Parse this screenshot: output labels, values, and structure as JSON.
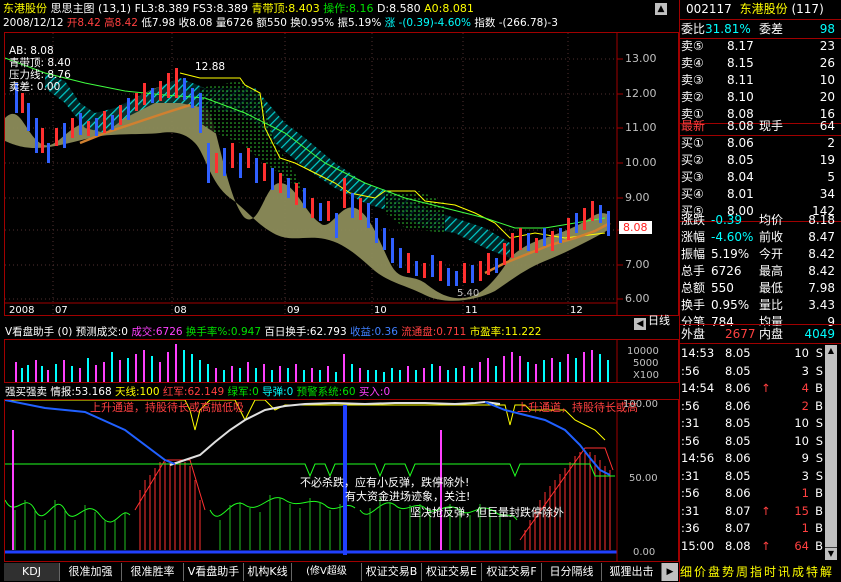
{
  "title_bar": {
    "stock_name": "东港股份",
    "indicator": "思思主图",
    "params": "(13,1)",
    "fl3": "FL3:8.389",
    "fs3": "FS3:8.389",
    "qingdai": "青带顶:8.403",
    "caozuo": "操作:8.16",
    "d": "D:8.580",
    "a0": "A0:8.081"
  },
  "info_bar": {
    "date": "2008/12/12",
    "open": "开8.42",
    "high": "高8.42",
    "low": "低7.98",
    "close": "收8.08",
    "volume": "量6726",
    "amount": "额550",
    "turnover": "换0.95%",
    "amplitude": "振5.19%",
    "change": "涨 -(0.39)-4.60%",
    "index": "指数 -(266.78)-3"
  },
  "main_legend": {
    "ab": "AB: 8.08",
    "qingdai": "青带顶: 8.40",
    "yali": "压力线: 8.76",
    "maicha": "卖差: 0.00"
  },
  "price_chart": {
    "ticks": [
      "13.00",
      "12.00",
      "11.00",
      "10.00",
      "9.00",
      "8.00",
      "7.00",
      "6.00"
    ],
    "high_label": "12.88",
    "low_label": "5.40",
    "current_price": "8.08",
    "x_labels": [
      "2008",
      "07",
      "08",
      "09",
      "10",
      "11",
      "12"
    ],
    "tail_label": "日线"
  },
  "volume_panel": {
    "label": "V看盘助手 (0)",
    "yuce": "预测成交:0",
    "chengjiao": "成交:6726",
    "huanshou": "换手率%:0.947",
    "baiday": "百日换手:62.793",
    "shouyi": "收益:0.36",
    "liutong": "流通盘:0.711",
    "pe": "市盈率:11.222",
    "ticks": [
      "10000",
      "5000",
      "X100"
    ]
  },
  "signal_panel": {
    "label": "强买强卖",
    "qingbao": "情报:53.168",
    "tianxian": "天线:100",
    "hongjun": "红军:62.149",
    "lvjun": "绿军:0",
    "daodan": "导弹:0",
    "yujing": "预警系统:60",
    "mairu": "买入:0",
    "ticks": [
      "100.00",
      "50.00",
      "0.00"
    ],
    "text_upper1": "上升通道，持股待长或高抛低吸",
    "text_upper2": "上升通道，持股待长或高",
    "text_mid1": "不必杀跌，应有小反弹，跌停除外!",
    "text_mid2": "有大资金进场迹象，关注!",
    "text_mid3": "坚决抢反弹，但巨量封跌停除外"
  },
  "tabs": [
    "KDJ",
    "很准加强",
    "很准胜率",
    "V看盘助手",
    "机构K线",
    "(修V超级MACD)",
    "权证交易B",
    "权证交易E",
    "权证交易F",
    "日分隔线",
    "狐狸出击"
  ],
  "quote": {
    "code": "002117",
    "name": "东港股份",
    "count": "(117)",
    "weibi_label": "委比",
    "weibi": "31.81%",
    "weicha_label": "委差",
    "weicha": "98",
    "sell": [
      {
        "label": "卖⑤",
        "price": "8.17",
        "vol": "23"
      },
      {
        "label": "卖④",
        "price": "8.15",
        "vol": "26"
      },
      {
        "label": "卖③",
        "price": "8.11",
        "vol": "10"
      },
      {
        "label": "卖②",
        "price": "8.10",
        "vol": "20"
      },
      {
        "label": "卖①",
        "price": "8.08",
        "vol": "16"
      }
    ],
    "buy": [
      {
        "label": "买①",
        "price": "8.06",
        "vol": "2"
      },
      {
        "label": "买②",
        "price": "8.05",
        "vol": "19"
      },
      {
        "label": "买③",
        "price": "8.04",
        "vol": "5"
      },
      {
        "label": "买④",
        "price": "8.01",
        "vol": "34"
      },
      {
        "label": "买⑤",
        "price": "8.00",
        "vol": "142"
      }
    ],
    "latest_label": "最新",
    "latest": "8.08",
    "xianshou_label": "现手",
    "xianshou": "64",
    "stats": [
      {
        "l1": "涨跌",
        "v1": "-0.39",
        "l2": "均价",
        "v2": "8.18"
      },
      {
        "l1": "涨幅",
        "v1": "-4.60%",
        "l2": "前收",
        "v2": "8.47"
      },
      {
        "l1": "振幅",
        "v1": "5.19%",
        "l2": "今开",
        "v2": "8.42"
      },
      {
        "l1": "总手",
        "v1": "6726",
        "l2": "最高",
        "v2": "8.42"
      },
      {
        "l1": "总额",
        "v1": "550",
        "l2": "最低",
        "v2": "7.98"
      },
      {
        "l1": "换手",
        "v1": "0.95%",
        "l2": "量比",
        "v2": "3.43"
      },
      {
        "l1": "分笔",
        "v1": "784",
        "l2": "均量",
        "v2": "9"
      }
    ],
    "waipan_label": "外盘",
    "waipan": "2677",
    "neipan_label": "内盘",
    "neipan": "4049"
  },
  "ticks_list": [
    {
      "time": "14:53",
      "price": "8.05",
      "arrow": "",
      "vol": "10",
      "side": "S"
    },
    {
      "time": ":56",
      "price": "8.05",
      "arrow": "",
      "vol": "3",
      "side": "S"
    },
    {
      "time": "14:54",
      "price": "8.06",
      "arrow": "↑",
      "vol": "4",
      "side": "B"
    },
    {
      "time": ":56",
      "price": "8.06",
      "arrow": "",
      "vol": "2",
      "side": "B"
    },
    {
      "time": ":31",
      "price": "8.05",
      "arrow": "",
      "vol": "10",
      "side": "S"
    },
    {
      "time": ":56",
      "price": "8.05",
      "arrow": "",
      "vol": "10",
      "side": "S"
    },
    {
      "time": "14:56",
      "price": "8.06",
      "arrow": "",
      "vol": "9",
      "side": "S"
    },
    {
      "time": ":31",
      "price": "8.05",
      "arrow": "",
      "vol": "3",
      "side": "S"
    },
    {
      "time": ":56",
      "price": "8.06",
      "arrow": "",
      "vol": "1",
      "side": "B"
    },
    {
      "time": ":31",
      "price": "8.07",
      "arrow": "↑",
      "vol": "15",
      "side": "B"
    },
    {
      "time": ":36",
      "price": "8.07",
      "arrow": "",
      "vol": "1",
      "side": "B"
    },
    {
      "time": "15:00",
      "price": "8.08",
      "arrow": "↑",
      "vol": "64",
      "side": "B"
    }
  ],
  "bottom_tabs": [
    "细",
    "价",
    "盘",
    "势",
    "周",
    "指",
    "时",
    "讯",
    "成",
    "特",
    "解"
  ]
}
